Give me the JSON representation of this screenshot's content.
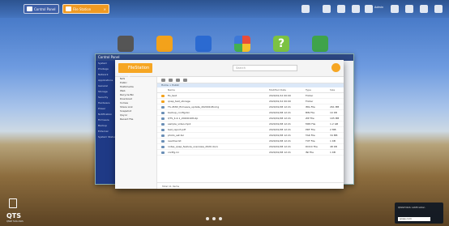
{
  "tabs": [
    {
      "label": "Control Panel"
    },
    {
      "label": "File Station"
    }
  ],
  "topbar": {
    "user_label": "Admin"
  },
  "control_panel": {
    "title": "Control Panel",
    "nav": [
      "System",
      "Privilege",
      "Network",
      "Applications",
      "General",
      "Storage",
      "Security",
      "Hardware",
      "Power",
      "Notification",
      "Firmware",
      "Backup",
      "External",
      "System Status"
    ]
  },
  "file_station": {
    "logo": "FileStation 5",
    "search_placeholder": "Search",
    "sidebar": [
      "NAS",
      "Public",
      "Multimedia",
      "Web",
      "Recycle Bin",
      "Download",
      "homes",
      "Share Link",
      "Snapshot",
      "Qsync",
      "Recent File"
    ],
    "path": "Home > Public",
    "columns": [
      "Name",
      "Modified Date",
      "Type",
      "Size"
    ],
    "rows": [
      {
        "type": "folder",
        "name": "fio_test",
        "date": "2020/01/12 00:00",
        "kind": "Folder",
        "size": ""
      },
      {
        "type": "folder",
        "name": "qnap_test_storage",
        "date": "2020/01/12 00:00",
        "kind": "Folder",
        "size": ""
      },
      {
        "type": "file",
        "name": "TS-453D_firmware_update_20200108.img",
        "date": "2020/01/08 12:21",
        "kind": "IMG File",
        "size": "261 MB"
      },
      {
        "type": "file",
        "name": "backup_config.bin",
        "date": "2020/01/08 12:21",
        "kind": "BIN File",
        "size": "10 KB"
      },
      {
        "type": "file",
        "name": "QTS_4.4.1_20200108.zip",
        "date": "2020/01/08 12:21",
        "kind": "ZIP File",
        "size": "195 MB"
      },
      {
        "type": "file",
        "name": "sample_video.mp4",
        "date": "2020/01/08 12:21",
        "kind": "MP4 File",
        "size": "1.2 GB"
      },
      {
        "type": "file",
        "name": "test_report.pdf",
        "date": "2020/01/08 12:21",
        "kind": "PDF File",
        "size": "2 MB"
      },
      {
        "type": "file",
        "name": "photo_set.tar",
        "date": "2020/01/08 12:21",
        "kind": "TAR File",
        "size": "34 MB"
      },
      {
        "type": "file",
        "name": "readme.txt",
        "date": "2020/01/08 12:21",
        "kind": "TXT File",
        "size": "1 KB"
      },
      {
        "type": "file",
        "name": "notes_qnap_feature_overview_2020.docx",
        "date": "2020/01/08 12:21",
        "kind": "DOCX File",
        "size": "48 KB"
      },
      {
        "type": "file",
        "name": "config.ini",
        "date": "2020/01/08 12:21",
        "kind": "INI File",
        "size": "1 KB"
      }
    ],
    "footer": "Total 11 items"
  },
  "desktop": {
    "brand": "QTS",
    "brand_sub": "QNAP Turbo NAS"
  },
  "notification": {
    "text": "QNAP NAS notification",
    "bar": "qnap.com"
  }
}
